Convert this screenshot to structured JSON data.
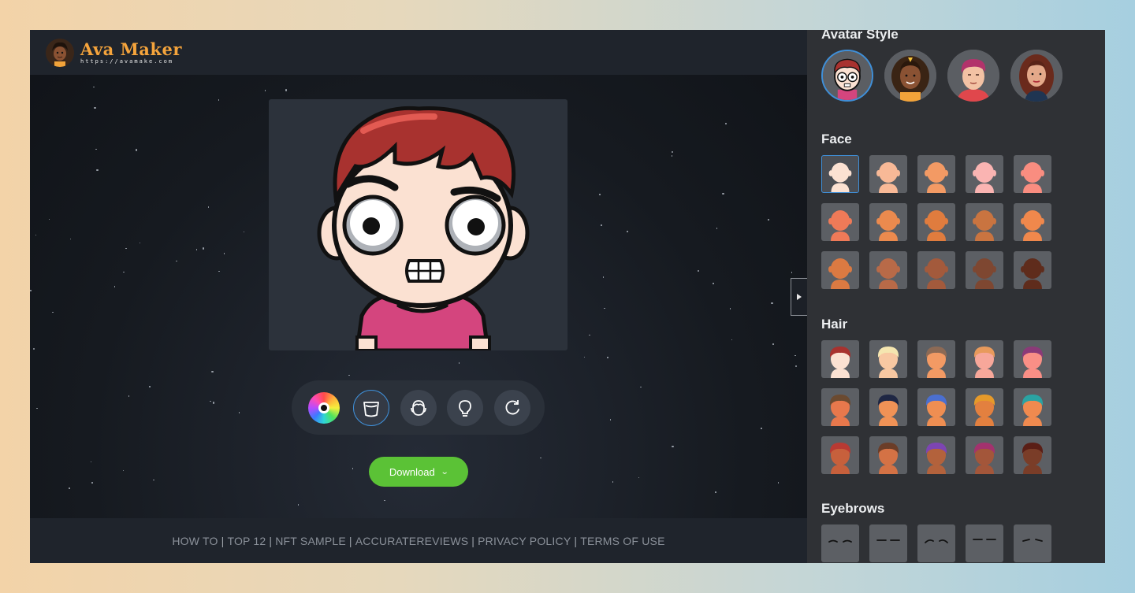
{
  "app": {
    "title": "Ava Maker",
    "url": "https://avamake.com"
  },
  "toolbar": {
    "tools": [
      {
        "name": "color-picker",
        "icon": "color-wheel-icon"
      },
      {
        "name": "shirt",
        "icon": "shirt-icon",
        "active": true
      },
      {
        "name": "face",
        "icon": "face-outline-icon"
      },
      {
        "name": "idea",
        "icon": "lightbulb-icon"
      },
      {
        "name": "reset",
        "icon": "refresh-icon"
      }
    ]
  },
  "download": {
    "label": "Download",
    "icon": "chevron-down-icon"
  },
  "footer": {
    "links": [
      "HOW TO",
      "TOP 12",
      "NFT SAMPLE",
      "ACCURATEREVIEWS",
      "PRIVACY POLICY",
      "TERMS OF USE"
    ],
    "separator": "|"
  },
  "panel": {
    "sections": {
      "avatar_style": "Avatar Style",
      "face": "Face",
      "hair": "Hair",
      "eyebrows": "Eyebrows"
    },
    "skin_tones": [
      "#fbe1d2",
      "#f8b997",
      "#f39a64",
      "#fab4b2",
      "#f98d80",
      "#ef7a58",
      "#eb8a4e",
      "#e07c3e",
      "#c97440",
      "#f0884c",
      "#db7a42",
      "#b86a48",
      "#a35a3c",
      "#7e4731",
      "#5f2c1c"
    ],
    "hair_options": [
      {
        "skin": "#fbe1d2",
        "hair": "#a8322f"
      },
      {
        "skin": "#f8c8a2",
        "hair": "#f5e6b0"
      },
      {
        "skin": "#f39a64",
        "hair": "#8d6a55"
      },
      {
        "skin": "#f7a79a",
        "hair": "#e89a5c"
      },
      {
        "skin": "#fa8f86",
        "hair": "#8b3a78"
      },
      {
        "skin": "#e8784c",
        "hair": "#6b4a30"
      },
      {
        "skin": "#f09256",
        "hair": "#1f2744"
      },
      {
        "skin": "#ef8e52",
        "hair": "#4b6fd0"
      },
      {
        "skin": "#e3803f",
        "hair": "#e69a2a"
      },
      {
        "skin": "#f08a4f",
        "hair": "#2aa3a3"
      },
      {
        "skin": "#c7603c",
        "hair": "#b83a33"
      },
      {
        "skin": "#d47245",
        "hair": "#6b3d28"
      },
      {
        "skin": "#b3623c",
        "hair": "#7d45b3"
      },
      {
        "skin": "#a3563a",
        "hair": "#a3326e"
      },
      {
        "skin": "#7a3d28",
        "hair": "#5a1e16"
      }
    ],
    "colors": {
      "accent": "#3f8fd8",
      "download": "#5bc236",
      "brand": "#f5a43c"
    }
  }
}
